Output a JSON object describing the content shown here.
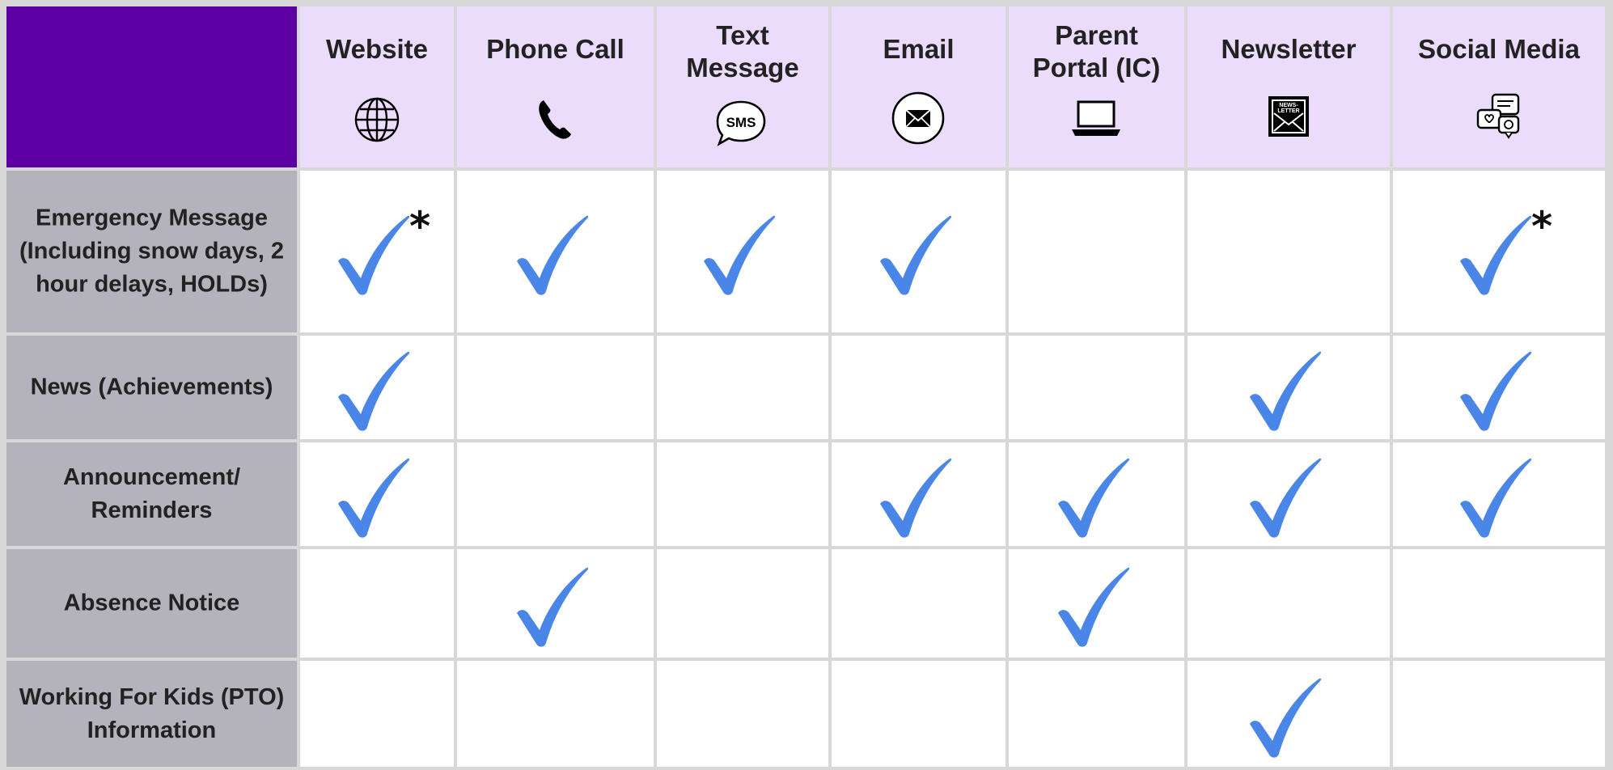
{
  "table": {
    "columns": [
      {
        "label": "Website",
        "icon": "globe-icon"
      },
      {
        "label": "Phone Call",
        "icon": "phone-icon"
      },
      {
        "label": "Text Message",
        "icon": "sms-bubble-icon"
      },
      {
        "label": "Email",
        "icon": "envelope-icon"
      },
      {
        "label": "Parent Portal (IC)",
        "icon": "laptop-icon"
      },
      {
        "label": "Newsletter",
        "icon": "newsletter-icon"
      },
      {
        "label": "Social Media",
        "icon": "social-media-icon"
      }
    ],
    "rows": [
      {
        "label": "Emergency Message (Including snow days, 2 hour delays, HOLDs)",
        "checks": [
          true,
          true,
          true,
          true,
          false,
          false,
          true
        ],
        "asterisks": [
          true,
          false,
          false,
          false,
          false,
          false,
          true
        ]
      },
      {
        "label": "News (Achievements)",
        "checks": [
          true,
          false,
          false,
          false,
          false,
          true,
          true
        ],
        "asterisks": [
          false,
          false,
          false,
          false,
          false,
          false,
          false
        ]
      },
      {
        "label": "Announcement/ Reminders",
        "checks": [
          true,
          false,
          false,
          true,
          true,
          true,
          true
        ],
        "asterisks": [
          false,
          false,
          false,
          false,
          false,
          false,
          false
        ]
      },
      {
        "label": "Absence Notice",
        "checks": [
          false,
          true,
          false,
          false,
          true,
          false,
          false
        ],
        "asterisks": [
          false,
          false,
          false,
          false,
          false,
          false,
          false
        ]
      },
      {
        "label": "Working For Kids (PTO) Information",
        "checks": [
          false,
          false,
          false,
          false,
          false,
          true,
          false
        ],
        "asterisks": [
          false,
          false,
          false,
          false,
          false,
          false,
          false
        ]
      }
    ],
    "asterisk_symbol": "*",
    "sms_icon_text": "SMS",
    "newsletter_icon_text": "NEWS-LETTER"
  },
  "colors": {
    "corner": "#5c00a3",
    "header_bg": "#ecdcfc",
    "row_label_bg": "#b4b2ba",
    "check": "#4a86e8",
    "grid": "#d8d8d8"
  }
}
